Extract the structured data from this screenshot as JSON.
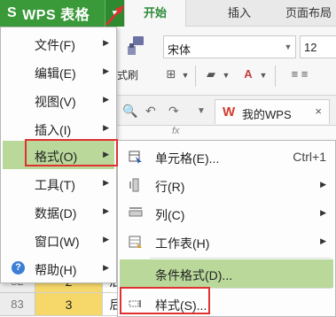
{
  "app": {
    "logo": "S",
    "name": "WPS 表格"
  },
  "tabs": [
    {
      "label": "开始",
      "active": true
    },
    {
      "label": "插入",
      "active": false
    },
    {
      "label": "页面布局",
      "active": false
    }
  ],
  "ribbon": {
    "format_painter_label": "式刷",
    "font_name": "宋体",
    "font_size": "12"
  },
  "quick_access": {
    "doc_tab_label": "我的WPS",
    "doc_tab_icon": "W",
    "fx_label": "fx"
  },
  "main_menu": {
    "items": [
      {
        "label": "文件(F)",
        "has_submenu": true
      },
      {
        "label": "编辑(E)",
        "has_submenu": true
      },
      {
        "label": "视图(V)",
        "has_submenu": true
      },
      {
        "label": "插入(I)",
        "has_submenu": true
      },
      {
        "label": "格式(O)",
        "has_submenu": true,
        "highlighted": true
      },
      {
        "label": "工具(T)",
        "has_submenu": true
      },
      {
        "label": "数据(D)",
        "has_submenu": true
      },
      {
        "label": "窗口(W)",
        "has_submenu": true
      },
      {
        "label": "帮助(H)",
        "has_submenu": true,
        "icon": "help-icon",
        "icon_glyph": "?"
      }
    ]
  },
  "submenu": {
    "items": [
      {
        "label": "单元格(E)...",
        "shortcut": "Ctrl+1",
        "icon": "cell-format-icon"
      },
      {
        "label": "行(R)",
        "has_submenu": true,
        "icon": "row-icon"
      },
      {
        "label": "列(C)",
        "has_submenu": true,
        "icon": "column-icon"
      },
      {
        "label": "工作表(H)",
        "has_submenu": true,
        "icon": "worksheet-icon"
      },
      {
        "label": "条件格式(D)...",
        "highlighted": true
      },
      {
        "label": "样式(S)...",
        "icon": "style-icon"
      }
    ]
  },
  "sheet": {
    "rows": [
      {
        "header": "82",
        "cells": [
          "2",
          "后"
        ]
      },
      {
        "header": "83",
        "cells": [
          "3",
          "后"
        ]
      }
    ]
  },
  "colors": {
    "app_green": "#3a9a3a",
    "active_tab_text": "#2e8b3a",
    "menu_highlight": "#b9d89a",
    "red_box": "#e03030",
    "cell_yellow": "#f6d86a"
  }
}
